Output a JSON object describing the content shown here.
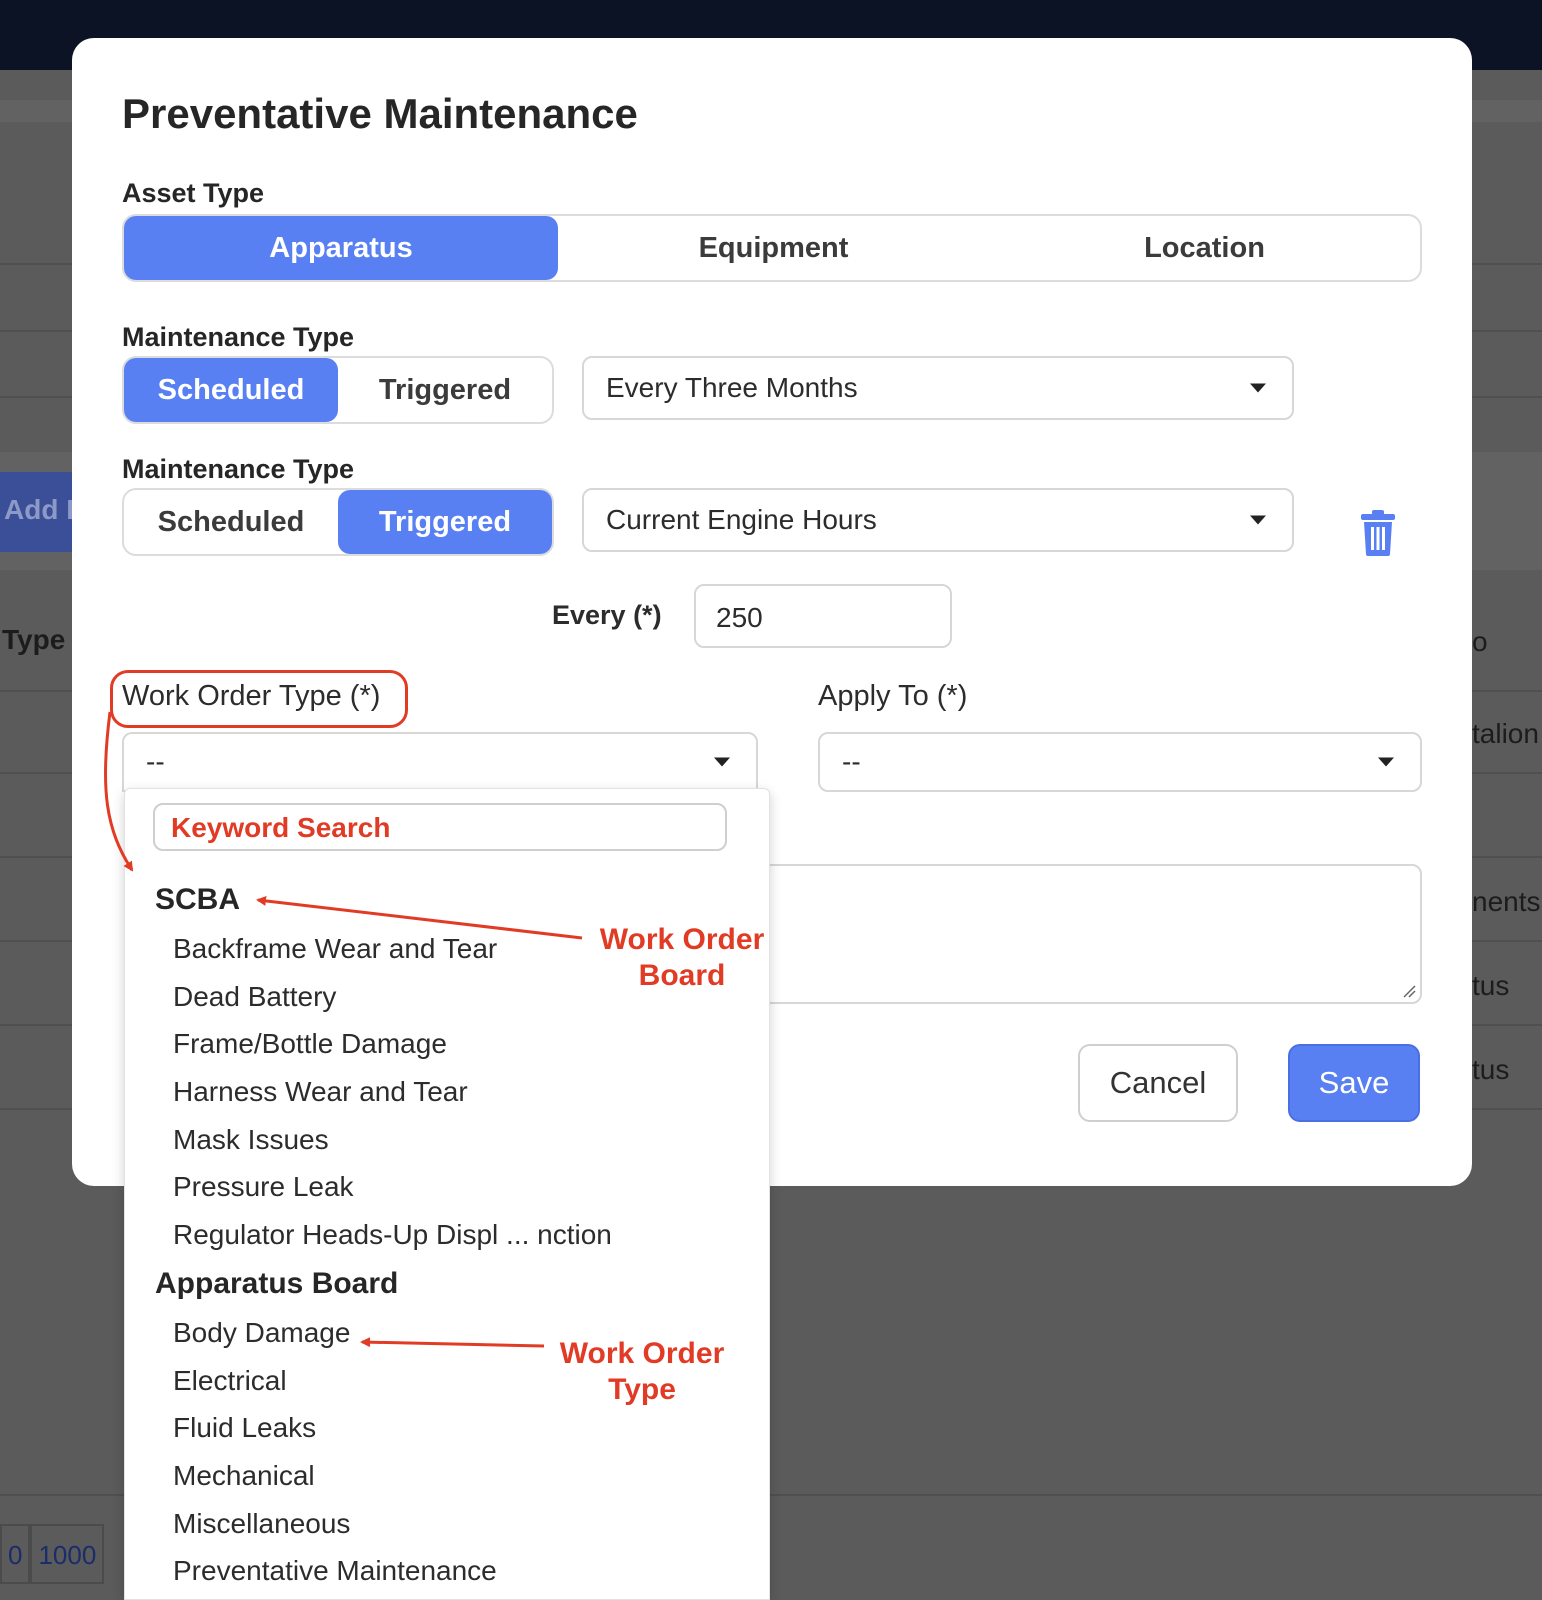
{
  "background": {
    "add_button": "Add I",
    "column_type": "Type",
    "right_clips": [
      "o",
      "talion",
      "nents",
      "tus",
      "tus"
    ],
    "pager": [
      "0",
      "1000"
    ]
  },
  "modal": {
    "title": "Preventative Maintenance",
    "asset_type": {
      "label": "Asset Type",
      "options": [
        "Apparatus",
        "Equipment",
        "Location"
      ],
      "selected": "Apparatus"
    },
    "maintenance_1": {
      "label": "Maintenance Type",
      "options": [
        "Scheduled",
        "Triggered"
      ],
      "selected": "Scheduled",
      "select_value": "Every Three Months"
    },
    "maintenance_2": {
      "label": "Maintenance Type",
      "options": [
        "Scheduled",
        "Triggered"
      ],
      "selected": "Triggered",
      "select_value": "Current Engine Hours"
    },
    "every": {
      "label": "Every (*)",
      "value": "250"
    },
    "work_order_type": {
      "label": "Work Order Type (*)",
      "value": "--"
    },
    "apply_to": {
      "label": "Apply To (*)",
      "value": "--"
    },
    "buttons": {
      "cancel": "Cancel",
      "save": "Save"
    }
  },
  "dropdown": {
    "search_placeholder": "Keyword Search",
    "groups": [
      {
        "name": "SCBA",
        "items": [
          "Backframe Wear and Tear",
          "Dead Battery",
          "Frame/Bottle Damage",
          "Harness Wear and Tear",
          "Mask Issues",
          "Pressure Leak",
          "Regulator Heads-Up Displ ... nction"
        ]
      },
      {
        "name": "Apparatus Board",
        "items": [
          "Body Damage",
          "Electrical",
          "Fluid Leaks",
          "Mechanical",
          "Miscellaneous",
          "Preventative Maintenance"
        ]
      }
    ]
  },
  "annotations": {
    "work_order_board": [
      "Work Order",
      "Board"
    ],
    "work_order_type": [
      "Work Order",
      "Type"
    ],
    "color": "#e23b25"
  },
  "colors": {
    "accent": "#5880f2",
    "topbar": "#0c1324",
    "annotation": "#e23b25"
  }
}
